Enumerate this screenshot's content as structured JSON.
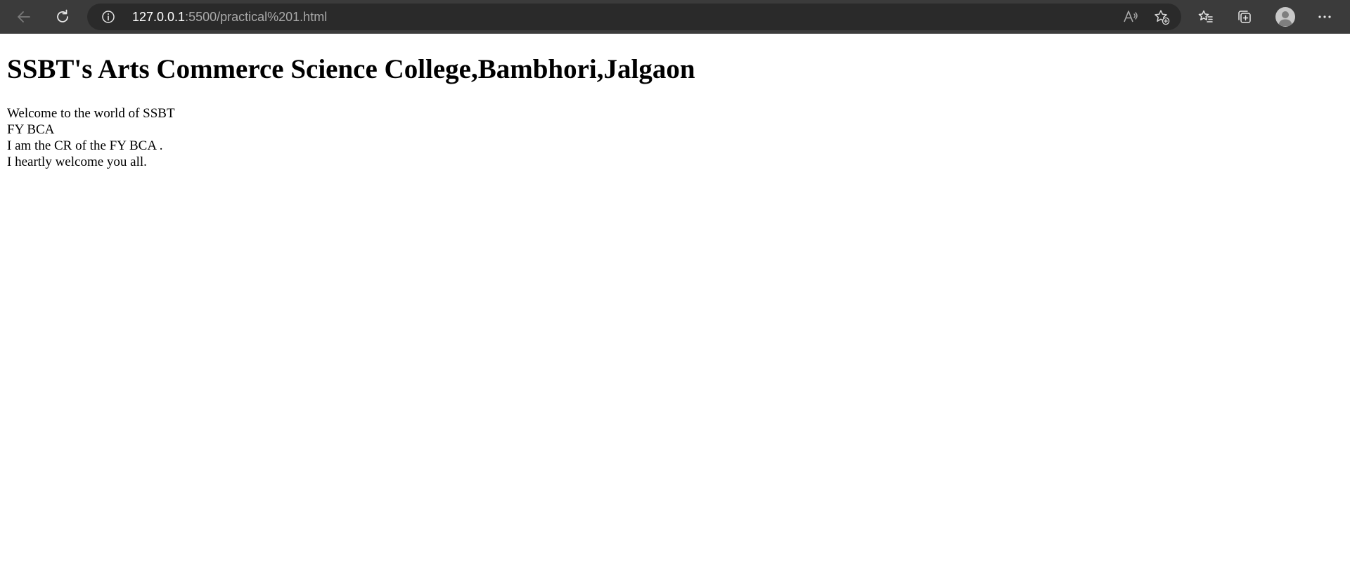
{
  "browser": {
    "url_host": "127.0.0.1",
    "url_path": ":5500/practical%201.html",
    "icons": {
      "back": "back-arrow-icon",
      "refresh": "refresh-icon",
      "site_info": "info-icon",
      "read_aloud": "read-aloud-icon",
      "add_favorite": "add-favorite-icon",
      "favorites": "favorites-icon",
      "collections": "collections-icon",
      "profile": "profile-avatar-icon",
      "menu": "more-options-icon"
    },
    "colors": {
      "toolbar": "#3b3b3b",
      "address_bar": "#2a2a2a",
      "icon": "#e6e6e6",
      "icon_disabled": "#7a7a7a"
    }
  },
  "page": {
    "heading": "SSBT's Arts Commerce Science College,Bambhori,Jalgaon",
    "lines": [
      "Welcome to the world of SSBT",
      "FY BCA",
      "I am the CR of the FY BCA .",
      "I heartly welcome you all."
    ]
  }
}
